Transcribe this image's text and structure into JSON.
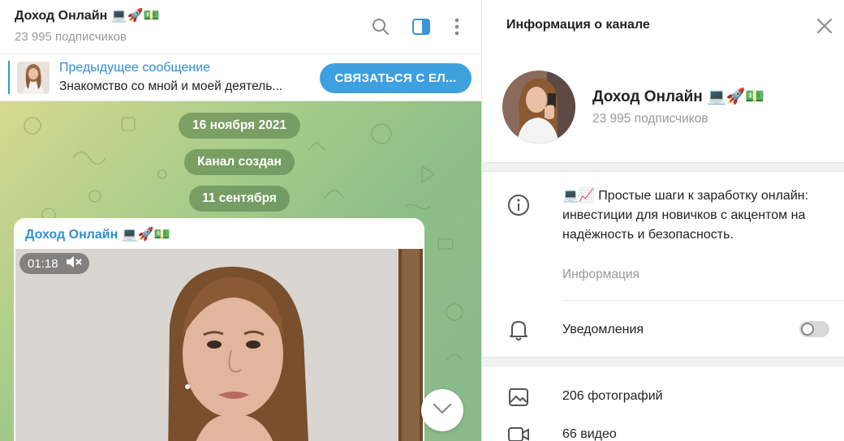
{
  "chat": {
    "title": "Доход Онлайн 💻🚀💵",
    "subscribers": "23 995 подписчиков",
    "icons": [
      "search-icon",
      "sidebar-toggle-icon",
      "more-vert-icon"
    ]
  },
  "pinned": {
    "title": "Предыдущее сообщение",
    "text": "Знакомство со мной и моей деятель...",
    "button": "СВЯЗАТЬСЯ С ЕЛ..."
  },
  "service": {
    "date1": "16 ноября 2021",
    "created": "Канал создан",
    "date2": "11 сентября"
  },
  "message": {
    "author": "Доход Онлайн 💻🚀💵",
    "video_duration": "01:18"
  },
  "info": {
    "header": "Информация о канале",
    "name": "Доход Онлайн 💻🚀💵",
    "subscribers": "23 995 подписчиков",
    "description": "💻📈 Простые шаги к заработку онлайн: инвестиции для новичков с акцентом на надёжность и безопасность.",
    "description_label": "Информация",
    "notifications_label": "Уведомления",
    "notifications_on": false,
    "media": {
      "photos": "206 фотографий",
      "videos": "66 видео"
    }
  },
  "colors": {
    "accent": "#3a95d5",
    "button": "#3fa0e0",
    "muted": "#999999"
  }
}
